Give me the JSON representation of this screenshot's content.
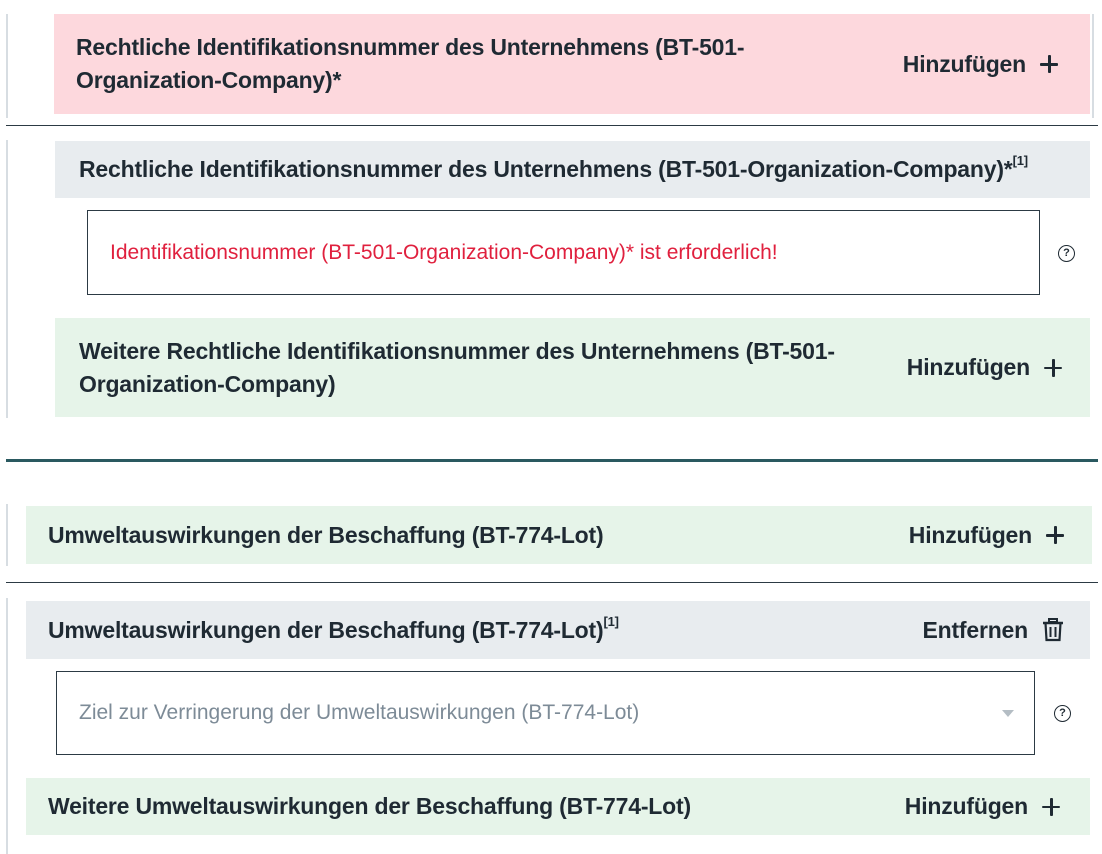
{
  "section1": {
    "required_header": {
      "label": "Rechtliche Identifikationsnummer des Unternehmens (BT-501-Organization-Company)*",
      "action_label": "Hinzufügen"
    },
    "filled_header": {
      "label": "Rechtliche Identifikationsnummer des Unternehmens (BT-501-Organization-Company)*",
      "index": "[1]"
    },
    "id_field": {
      "error_text": "Identifikationsnummer (BT-501-Organization-Company)* ist erforderlich!",
      "help_symbol": "?"
    },
    "more_header": {
      "label": "Weitere Rechtliche Identifikationsnummer des Unternehmens (BT-501-Organization-Company)",
      "action_label": "Hinzufügen"
    }
  },
  "section2": {
    "empty_header": {
      "label": "Umweltauswirkungen der Beschaffung (BT-774-Lot)",
      "action_label": "Hinzufügen"
    },
    "filled_header": {
      "label": "Umweltauswirkungen der Beschaffung (BT-774-Lot)",
      "index": "[1]",
      "action_label": "Entfernen"
    },
    "select_field": {
      "placeholder": "Ziel zur Verringerung der Umweltauswirkungen (BT-774-Lot)",
      "help_symbol": "?"
    },
    "more_header": {
      "label": "Weitere Umweltauswirkungen der Beschaffung (BT-774-Lot)",
      "action_label": "Hinzufügen"
    }
  },
  "icons": {
    "add": "plus-icon",
    "remove": "trash-icon",
    "help": "question-circle-icon",
    "dropdown": "caret-down-icon"
  },
  "colors": {
    "required_bg": "#fdd8dd",
    "optional_bg": "#e6f4e9",
    "filled_bg": "#e8ecef",
    "error_text": "#e0203e",
    "section_divider": "#2a5960"
  }
}
